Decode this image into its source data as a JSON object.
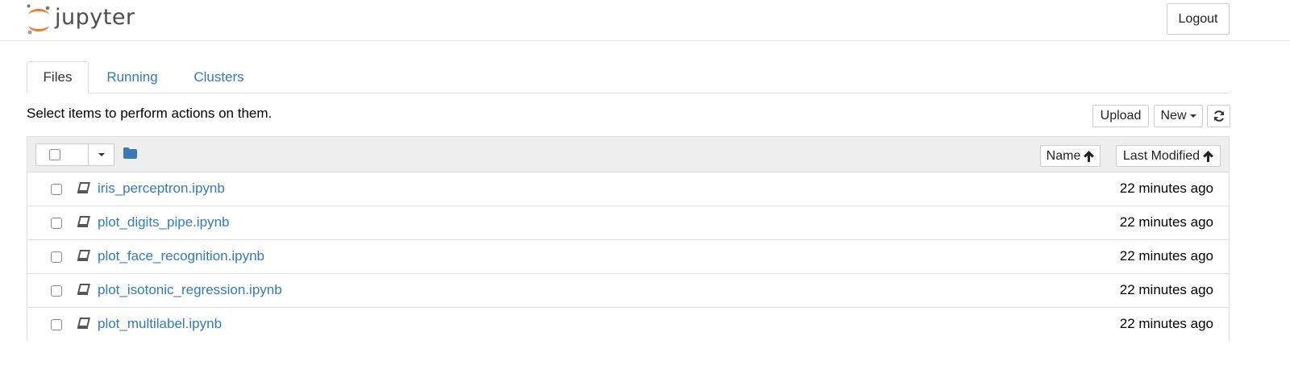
{
  "header": {
    "logo_text": "jupyter",
    "logout_label": "Logout"
  },
  "tabs": [
    {
      "label": "Files",
      "active": true
    },
    {
      "label": "Running",
      "active": false
    },
    {
      "label": "Clusters",
      "active": false
    }
  ],
  "instructions": "Select items to perform actions on them.",
  "toolbar": {
    "upload_label": "Upload",
    "new_label": "New",
    "refresh_icon": "refresh-icon"
  },
  "list_header": {
    "folder_icon": "folder-icon",
    "sort_name_label": "Name",
    "sort_modified_label": "Last Modified",
    "sort_icon": "arrow-up-icon"
  },
  "files": [
    {
      "name": "iris_perceptron.ipynb",
      "modified": "22 minutes ago",
      "icon": "notebook-icon"
    },
    {
      "name": "plot_digits_pipe.ipynb",
      "modified": "22 minutes ago",
      "icon": "notebook-icon"
    },
    {
      "name": "plot_face_recognition.ipynb",
      "modified": "22 minutes ago",
      "icon": "notebook-icon"
    },
    {
      "name": "plot_isotonic_regression.ipynb",
      "modified": "22 minutes ago",
      "icon": "notebook-icon"
    },
    {
      "name": "plot_multilabel.ipynb",
      "modified": "22 minutes ago",
      "icon": "notebook-icon"
    }
  ],
  "colors": {
    "link": "#337ab7",
    "logo_orange": "#f37726",
    "header_bg": "#eeeeee",
    "folder": "#3b78b4"
  }
}
